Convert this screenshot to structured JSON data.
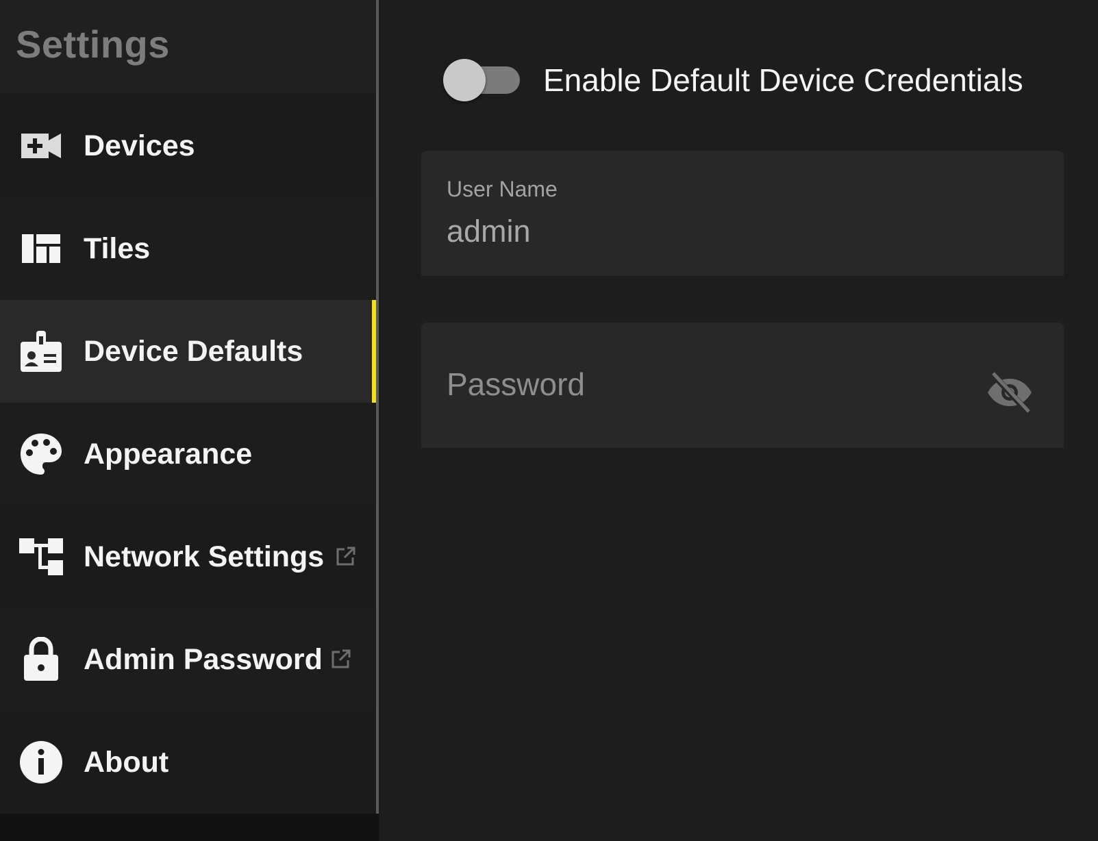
{
  "sidebar": {
    "title": "Settings",
    "items": [
      {
        "label": "Devices",
        "icon": "video-camera-add-icon",
        "external": false,
        "active": false
      },
      {
        "label": "Tiles",
        "icon": "tiles-layout-icon",
        "external": false,
        "active": false
      },
      {
        "label": "Device Defaults",
        "icon": "badge-icon",
        "external": false,
        "active": true
      },
      {
        "label": "Appearance",
        "icon": "palette-icon",
        "external": false,
        "active": false
      },
      {
        "label": "Network Settings",
        "icon": "network-icon",
        "external": true,
        "active": false
      },
      {
        "label": "Admin Password",
        "icon": "lock-icon",
        "external": true,
        "active": false
      },
      {
        "label": "About",
        "icon": "info-icon",
        "external": false,
        "active": false
      }
    ]
  },
  "main": {
    "toggle": {
      "label": "Enable Default Device Credentials",
      "enabled": false
    },
    "username": {
      "label": "User Name",
      "value": "admin"
    },
    "password": {
      "placeholder": "Password",
      "visibility_icon": "eye-off-icon"
    }
  },
  "colors": {
    "accent": "#f3e20f",
    "sidebar_title": "#7d7d7d",
    "text": "#f4f4f4",
    "field_bg": "#282828"
  }
}
